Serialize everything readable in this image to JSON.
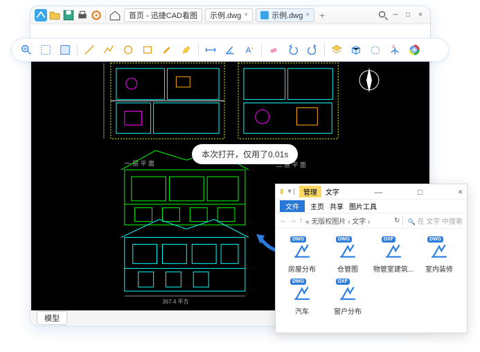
{
  "titlebar": {
    "home_label": "首页 - 迅捷CAD看图",
    "tabs": [
      {
        "label": "示例.dwg",
        "active": false
      },
      {
        "label": "示例.dwg",
        "active": true
      }
    ]
  },
  "toast": "本次打开，仅用了0.01s",
  "footer": {
    "tab": "模型"
  },
  "explorer": {
    "ribbon_badge": "管理",
    "ribbon_text": "文字",
    "tab_file": "文件",
    "tab_home": "主页",
    "tab_share": "共享",
    "tab_tools": "图片工具",
    "path": "« 无版权图片 › 文字 ›",
    "search_placeholder": "在 文字 中搜索",
    "files": [
      {
        "ext": "DWG",
        "label": "房屋分布"
      },
      {
        "ext": "DWG",
        "label": "仓管图"
      },
      {
        "ext": "DXF",
        "label": "物管室建筑..."
      },
      {
        "ext": "DWG",
        "label": "室内装修"
      },
      {
        "ext": "DWG",
        "label": "汽车"
      },
      {
        "ext": "DXF",
        "label": "窗户分布"
      }
    ]
  },
  "cad_labels": {
    "sub1": "二 层 平 面",
    "sub2": "一 层 平 面",
    "dim": "367.4 平方"
  }
}
